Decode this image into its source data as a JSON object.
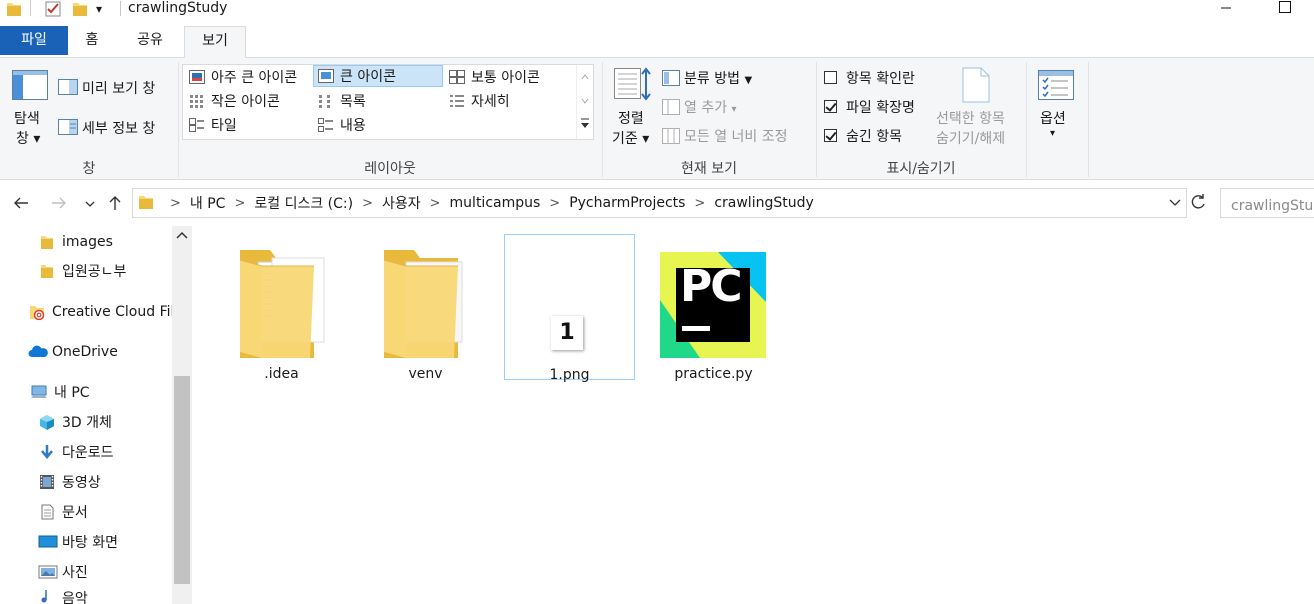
{
  "window": {
    "title": "crawlingStudy",
    "quick_access_dropdown": "▾"
  },
  "tabs": [
    {
      "label": "파일"
    },
    {
      "label": "홈"
    },
    {
      "label": "공유"
    },
    {
      "label": "보기"
    }
  ],
  "ribbon": {
    "panes": {
      "label": "창",
      "nav_pane": "탐색",
      "nav_pane_2": "창",
      "preview": "미리 보기 창",
      "details": "세부 정보 창"
    },
    "layout": {
      "label": "레이아웃",
      "items": [
        "아주 큰 아이콘",
        "큰 아이콘",
        "보통 아이콘",
        "작은 아이콘",
        "목록",
        "자세히",
        "타일",
        "내용"
      ],
      "selected": "큰 아이콘"
    },
    "current_view": {
      "label": "현재 보기",
      "sort": "정렬",
      "sort_2": "기준",
      "group_by": "분류 방법",
      "add_column": "열 추가",
      "fit_columns": "모든 열 너비 조정"
    },
    "show_hide": {
      "label": "표시/숨기기",
      "item_checkboxes": "항목 확인란",
      "file_extensions": "파일 확장명",
      "hidden_items": "숨긴 항목",
      "hide_selected": "선택한 항목",
      "hide_selected_2": "숨기기/해제",
      "options": "옵션",
      "checks": {
        "item_checkboxes": false,
        "file_extensions": true,
        "hidden_items": true
      }
    }
  },
  "address": {
    "crumbs": [
      "내 PC",
      "로컬 디스크 (C:)",
      "사용자",
      "multicampus",
      "PycharmProjects",
      "crawlingStudy"
    ],
    "search_placeholder": "crawlingStudy 검색"
  },
  "nav_pane": {
    "items": [
      {
        "label": "images",
        "icon": "folder-icon"
      },
      {
        "label": "입원공ㄴ부",
        "icon": "folder-icon"
      },
      {
        "label": "Creative Cloud Files",
        "icon": "creative-cloud-icon"
      },
      {
        "label": "OneDrive",
        "icon": "onedrive-icon"
      },
      {
        "label": "내 PC",
        "icon": "pc-icon"
      },
      {
        "label": "3D 개체",
        "icon": "3d-objects-icon"
      },
      {
        "label": "다운로드",
        "icon": "download-icon"
      },
      {
        "label": "동영상",
        "icon": "video-icon"
      },
      {
        "label": "문서",
        "icon": "document-icon"
      },
      {
        "label": "바탕 화면",
        "icon": "desktop-icon"
      },
      {
        "label": "사진",
        "icon": "pictures-icon"
      },
      {
        "label": "음악",
        "icon": "music-icon"
      }
    ]
  },
  "files": [
    {
      "name": ".idea",
      "type": "folder"
    },
    {
      "name": "venv",
      "type": "folder"
    },
    {
      "name": "1.png",
      "type": "image",
      "thumb_text": "1",
      "selected": true
    },
    {
      "name": "practice.py",
      "type": "pycharm",
      "logo_text": "PC"
    }
  ],
  "colors": {
    "accent": "#1a62b8",
    "selection": "#cce4f7",
    "folder": "#f8d775"
  }
}
